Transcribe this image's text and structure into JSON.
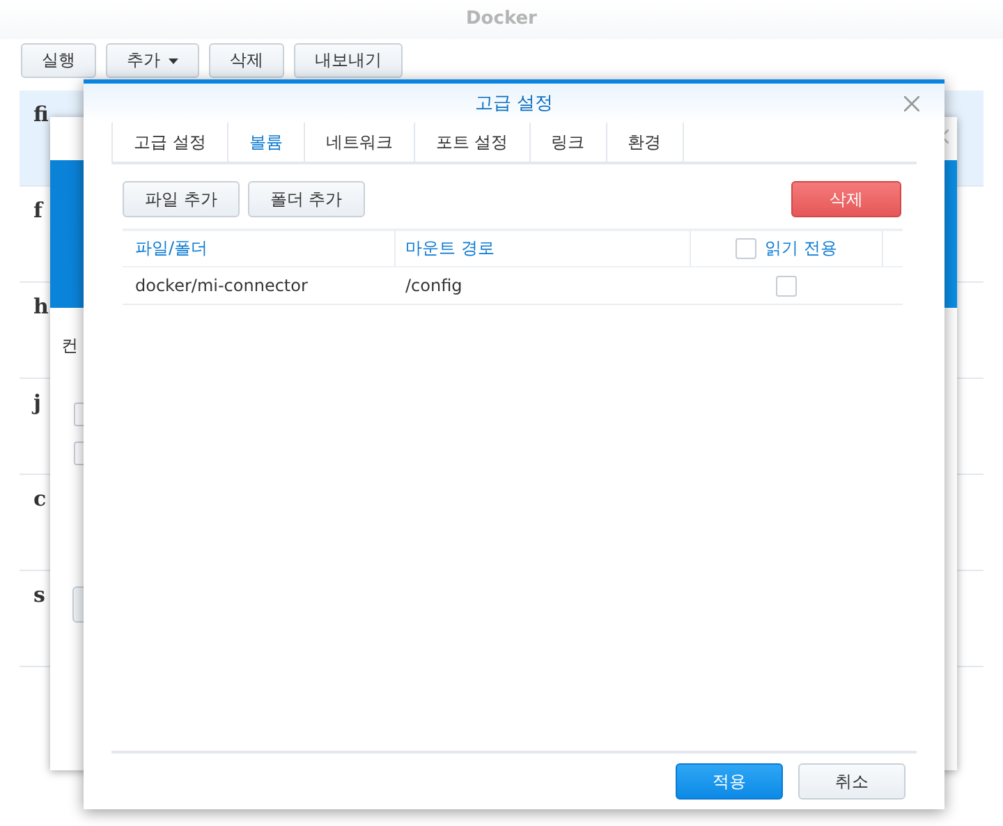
{
  "app": {
    "title": "Docker",
    "toolbar": [
      {
        "label": "실행",
        "kind": "plain"
      },
      {
        "label": "추가",
        "kind": "dropdown"
      },
      {
        "label": "삭제",
        "kind": "plain"
      },
      {
        "label": "내보내기",
        "kind": "plain"
      }
    ],
    "containers": [
      {
        "name": "fi",
        "selected": true
      },
      {
        "name": "f",
        "selected": false
      },
      {
        "name": "h",
        "selected": false
      },
      {
        "name": "j",
        "selected": false
      },
      {
        "name": "c",
        "selected": false
      },
      {
        "name": "s",
        "selected": false
      }
    ]
  },
  "back_window": {
    "text": "컨",
    "checkboxes": [
      {
        "checked": false
      },
      {
        "checked": false
      }
    ]
  },
  "dialog": {
    "title": "고급 설정",
    "tabs": [
      {
        "label": "고급 설정",
        "selected": false
      },
      {
        "label": "볼륨",
        "selected": true
      },
      {
        "label": "네트워크",
        "selected": false
      },
      {
        "label": "포트 설정",
        "selected": false
      },
      {
        "label": "링크",
        "selected": false
      },
      {
        "label": "환경",
        "selected": false
      }
    ],
    "actions": [
      {
        "label": "파일 추가",
        "kind": "default"
      },
      {
        "label": "폴더 추가",
        "kind": "default"
      },
      {
        "label": "삭제",
        "kind": "danger"
      }
    ],
    "table": {
      "columns": [
        {
          "label": "파일/폴더"
        },
        {
          "label": "마운트 경로"
        },
        {
          "label": "읽기 전용",
          "checked": false
        }
      ],
      "rows": [
        {
          "path": "docker/mi-connector",
          "mount": "/config",
          "read_only": false
        }
      ]
    },
    "footer": [
      {
        "label": "적용",
        "kind": "primary"
      },
      {
        "label": "취소",
        "kind": "default"
      }
    ]
  }
}
